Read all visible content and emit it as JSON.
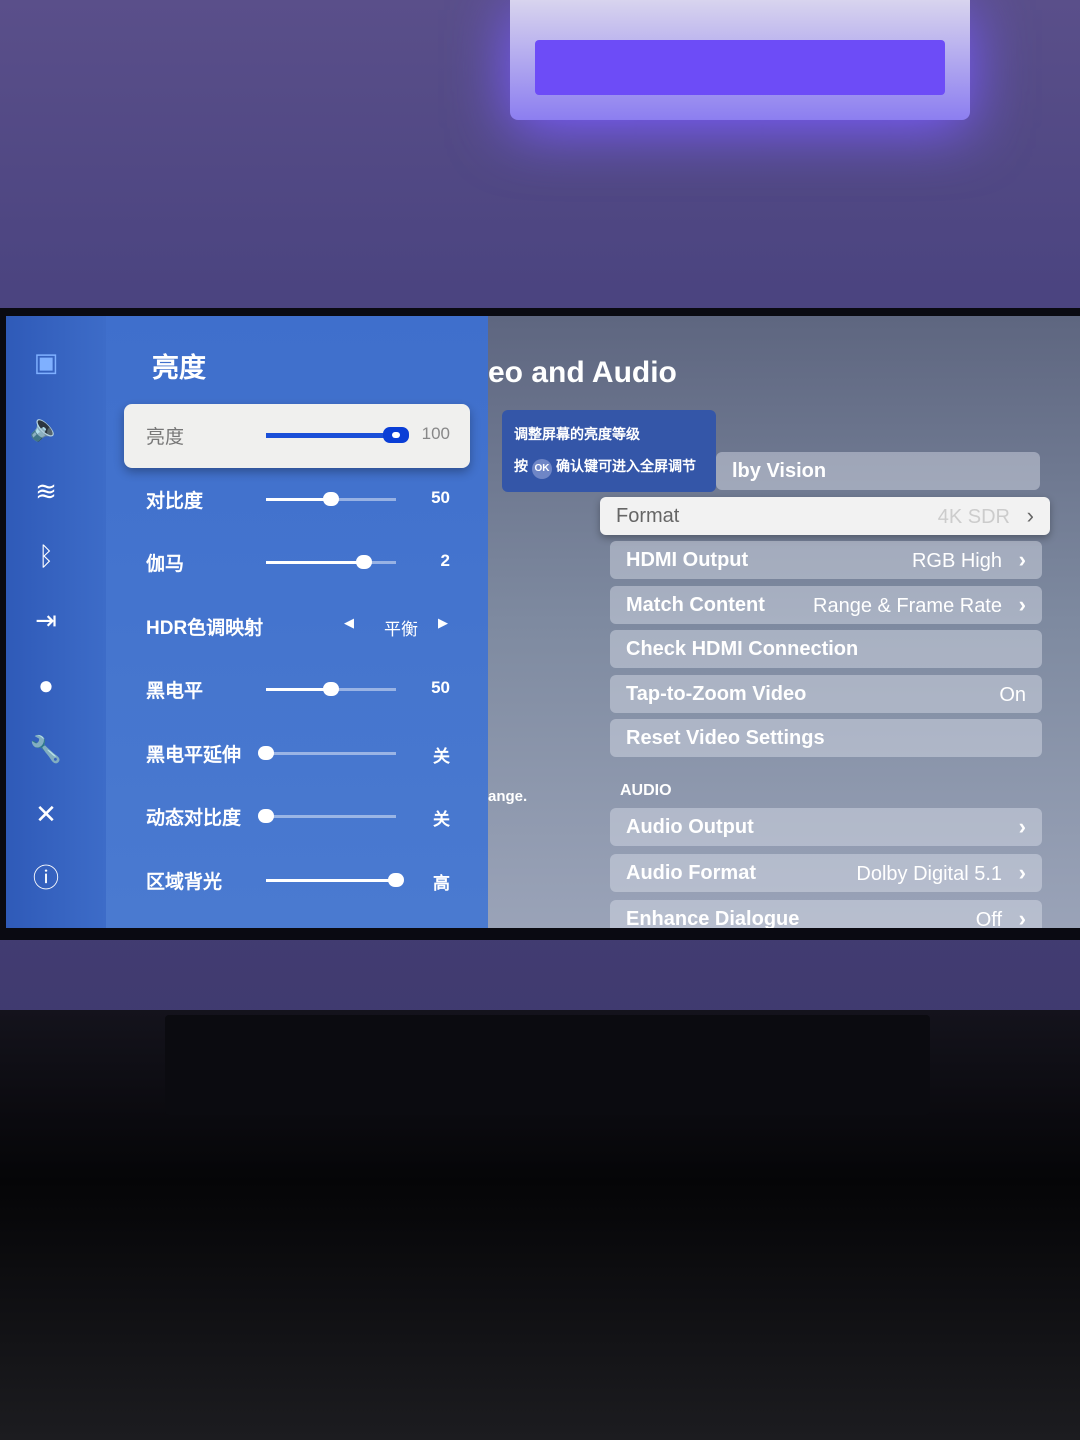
{
  "rail": {
    "icons": [
      "picture-icon",
      "sound-icon",
      "wifi-icon",
      "bluetooth-icon",
      "input-icon",
      "ai-icon",
      "wrench-icon",
      "tools-icon",
      "info-icon"
    ]
  },
  "panel": {
    "title": "亮度",
    "rows": [
      {
        "label": "亮度",
        "value": "100",
        "level": 1.0,
        "type": "slider"
      },
      {
        "label": "对比度",
        "value": "50",
        "level": 0.5,
        "type": "slider"
      },
      {
        "label": "伽马",
        "value": "2",
        "level": 0.75,
        "type": "slider"
      },
      {
        "label": "HDR色调映射",
        "value": "平衡",
        "type": "select"
      },
      {
        "label": "黑电平",
        "value": "50",
        "level": 0.5,
        "type": "slider"
      },
      {
        "label": "黑电平延伸",
        "value": "关",
        "level": 0,
        "type": "slider"
      },
      {
        "label": "动态对比度",
        "value": "关",
        "level": 0,
        "type": "slider"
      },
      {
        "label": "区域背光",
        "value": "高",
        "level": 1.0,
        "type": "slider"
      }
    ]
  },
  "tooltip": {
    "line1": "调整屏幕的亮度等级",
    "press": "按",
    "ok": "OK",
    "line2": "确认键可进入全屏调节"
  },
  "settings": {
    "heading": "eo and Audio",
    "fragment": "ange.",
    "items": [
      {
        "label": "lby Vision",
        "value": ""
      },
      {
        "label": "Format",
        "value": "4K SDR",
        "chevron": true,
        "focus": true
      },
      {
        "label": "HDMI Output",
        "value": "RGB High",
        "chevron": true
      },
      {
        "label": "Match Content",
        "value": "Range & Frame Rate",
        "chevron": true
      },
      {
        "label": "Check HDMI Connection",
        "value": ""
      },
      {
        "label": "Tap-to-Zoom Video",
        "value": "On"
      },
      {
        "label": "Reset Video Settings",
        "value": ""
      }
    ],
    "audio_section": "AUDIO",
    "audio_items": [
      {
        "label": "Audio Output",
        "value": "",
        "chevron": true
      },
      {
        "label": "Audio Format",
        "value": "Dolby Digital 5.1",
        "chevron": true
      },
      {
        "label": "Enhance Dialogue",
        "value": "Off",
        "chevron": true
      }
    ]
  },
  "colors": {
    "accent": "#0a3ed6",
    "panel": "#3f6fcc"
  }
}
